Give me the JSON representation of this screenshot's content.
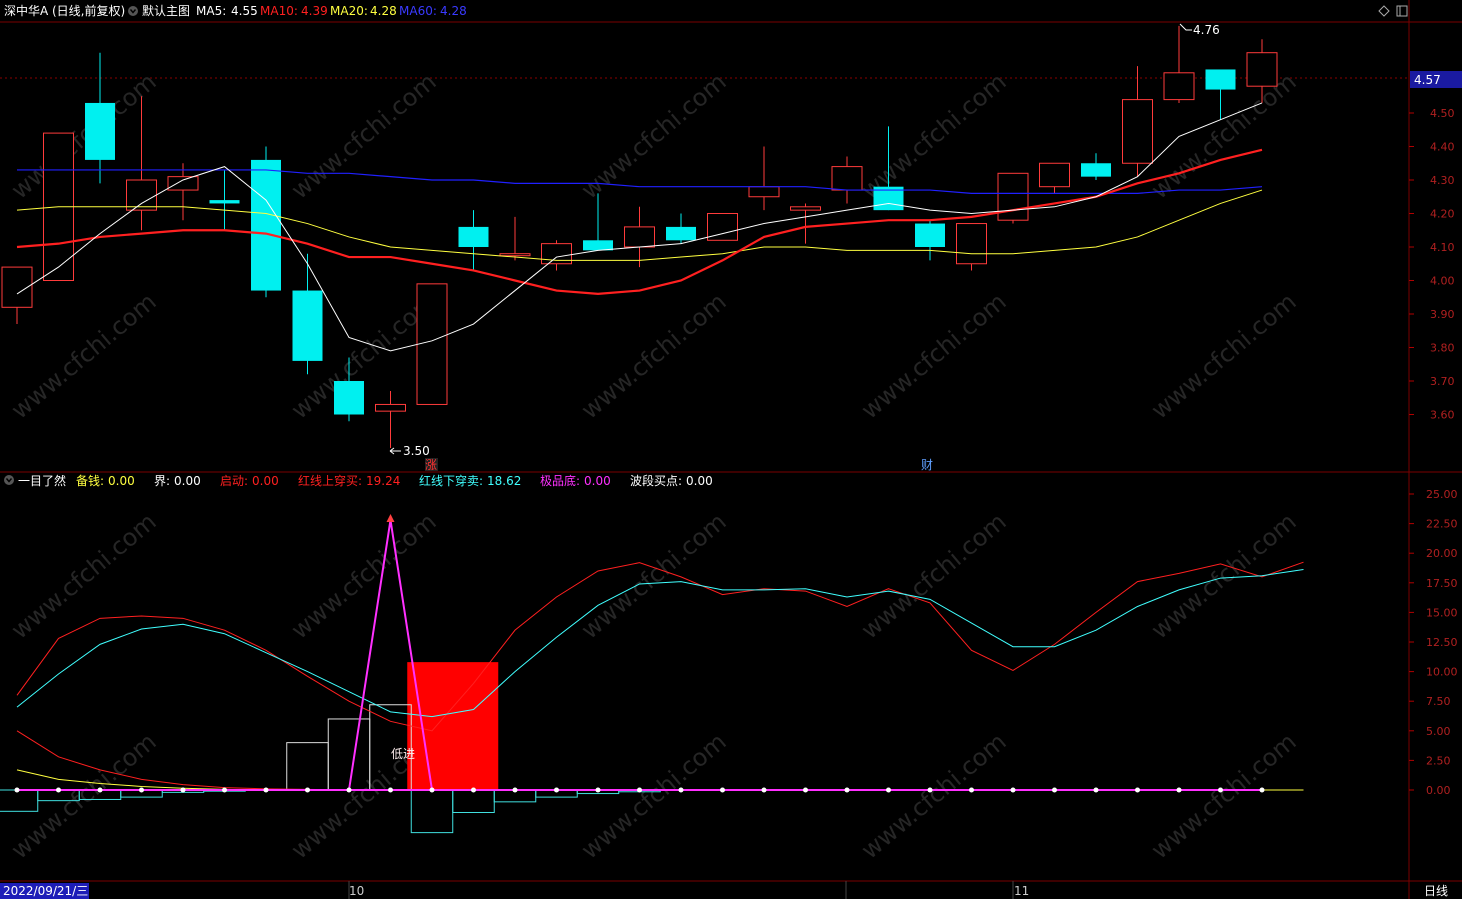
{
  "header": {
    "stock": "深中华A",
    "period_info": "(日线,前复权)",
    "template": "默认主图",
    "ma5": {
      "label": "MA5:",
      "value": "4.55",
      "color": "#ffffff"
    },
    "ma10": {
      "label": "MA10:",
      "value": "4.39",
      "color": "#ff2020"
    },
    "ma20": {
      "label": "MA20:",
      "value": "4.28",
      "color": "#ffff40"
    },
    "ma60": {
      "label": "MA60:",
      "value": "4.28",
      "color": "#2020ff"
    }
  },
  "indicator_header": {
    "name": "一目了然",
    "items": [
      {
        "label": "备钱:",
        "value": "0.00",
        "color": "#ffff40"
      },
      {
        "label": "界:",
        "value": "0.00",
        "color": "#ffffff"
      },
      {
        "label": "启动:",
        "value": "0.00",
        "color": "#ff2020"
      },
      {
        "label": "红线上穿买:",
        "value": "19.24",
        "color": "#ff2020"
      },
      {
        "label": "红线下穿卖:",
        "value": "18.62",
        "color": "#40ffff"
      },
      {
        "label": "极品底:",
        "value": "0.00",
        "color": "#ff30ff"
      },
      {
        "label": "波段买点:",
        "value": "0.00",
        "color": "#ffffff"
      }
    ]
  },
  "price_axis": {
    "ticks": [
      "4.50",
      "4.40",
      "4.30",
      "4.20",
      "4.10",
      "4.00",
      "3.90",
      "3.80",
      "3.70",
      "3.60"
    ],
    "current_price": "4.57",
    "current_price_bg": "#1a1aa0"
  },
  "indicator_axis": {
    "ticks": [
      "25.00",
      "22.50",
      "20.00",
      "17.50",
      "15.00",
      "12.50",
      "10.00",
      "7.50",
      "5.00",
      "2.50",
      "0.00"
    ]
  },
  "annotations": {
    "high_label": "4.76",
    "low_label": "3.50",
    "marker_zhang": "涨",
    "marker_cai": "财",
    "low_entry": "低进"
  },
  "date_axis": {
    "selected_date": "2022/09/21/三",
    "month_oct": "10",
    "month_nov": "11",
    "period": "日线"
  },
  "colors": {
    "up": "#ff3b3b",
    "down": "#00f0f0",
    "grid": "#7a0000"
  },
  "watermark": "www.cfchi.com",
  "chart_data": {
    "type": "candlestick",
    "candles": [
      {
        "o": 3.92,
        "h": 4.04,
        "l": 3.87,
        "c": 4.04
      },
      {
        "o": 4.0,
        "h": 4.44,
        "l": 4.0,
        "c": 4.44
      },
      {
        "o": 4.53,
        "h": 4.68,
        "l": 4.29,
        "c": 4.36
      },
      {
        "o": 4.21,
        "h": 4.55,
        "l": 4.15,
        "c": 4.3
      },
      {
        "o": 4.27,
        "h": 4.35,
        "l": 4.18,
        "c": 4.31
      },
      {
        "o": 4.24,
        "h": 4.33,
        "l": 4.15,
        "c": 4.23
      },
      {
        "o": 4.36,
        "h": 4.4,
        "l": 3.95,
        "c": 3.97
      },
      {
        "o": 3.97,
        "h": 4.08,
        "l": 3.72,
        "c": 3.76
      },
      {
        "o": 3.7,
        "h": 3.77,
        "l": 3.58,
        "c": 3.6
      },
      {
        "o": 3.61,
        "h": 3.67,
        "l": 3.5,
        "c": 3.63
      },
      {
        "o": 3.63,
        "h": 3.99,
        "l": 3.63,
        "c": 3.99
      },
      {
        "o": 4.16,
        "h": 4.21,
        "l": 4.03,
        "c": 4.1
      },
      {
        "o": 4.08,
        "h": 4.19,
        "l": 4.06,
        "c": 4.08
      },
      {
        "o": 4.05,
        "h": 4.12,
        "l": 4.03,
        "c": 4.11
      },
      {
        "o": 4.12,
        "h": 4.26,
        "l": 4.09,
        "c": 4.09
      },
      {
        "o": 4.1,
        "h": 4.22,
        "l": 4.04,
        "c": 4.16
      },
      {
        "o": 4.16,
        "h": 4.2,
        "l": 4.11,
        "c": 4.12
      },
      {
        "o": 4.12,
        "h": 4.2,
        "l": 4.12,
        "c": 4.2
      },
      {
        "o": 4.25,
        "h": 4.4,
        "l": 4.21,
        "c": 4.28
      },
      {
        "o": 4.21,
        "h": 4.23,
        "l": 4.11,
        "c": 4.22
      },
      {
        "o": 4.27,
        "h": 4.37,
        "l": 4.23,
        "c": 4.34
      },
      {
        "o": 4.28,
        "h": 4.46,
        "l": 4.21,
        "c": 4.21
      },
      {
        "o": 4.17,
        "h": 4.18,
        "l": 4.06,
        "c": 4.1
      },
      {
        "o": 4.05,
        "h": 4.17,
        "l": 4.03,
        "c": 4.17
      },
      {
        "o": 4.18,
        "h": 4.32,
        "l": 4.17,
        "c": 4.32
      },
      {
        "o": 4.28,
        "h": 4.35,
        "l": 4.26,
        "c": 4.35
      },
      {
        "o": 4.35,
        "h": 4.38,
        "l": 4.3,
        "c": 4.31
      },
      {
        "o": 4.35,
        "h": 4.64,
        "l": 4.31,
        "c": 4.54
      },
      {
        "o": 4.54,
        "h": 4.76,
        "l": 4.53,
        "c": 4.62
      },
      {
        "o": 4.63,
        "h": 4.63,
        "l": 4.48,
        "c": 4.57
      },
      {
        "o": 4.58,
        "h": 4.72,
        "l": 4.53,
        "c": 4.68
      }
    ],
    "ma5": [
      3.96,
      4.04,
      4.14,
      4.23,
      4.3,
      4.34,
      4.24,
      4.05,
      3.83,
      3.79,
      3.82,
      3.87,
      3.97,
      4.07,
      4.09,
      4.1,
      4.11,
      4.14,
      4.17,
      4.19,
      4.21,
      4.23,
      4.21,
      4.2,
      4.21,
      4.22,
      4.25,
      4.31,
      4.43,
      4.48,
      4.53
    ],
    "ma10": [
      4.1,
      4.11,
      4.13,
      4.14,
      4.15,
      4.15,
      4.14,
      4.11,
      4.07,
      4.07,
      4.05,
      4.03,
      4.0,
      3.97,
      3.96,
      3.97,
      4.0,
      4.06,
      4.13,
      4.16,
      4.17,
      4.18,
      4.18,
      4.19,
      4.21,
      4.23,
      4.25,
      4.29,
      4.32,
      4.36,
      4.39
    ],
    "ma20": [
      4.21,
      4.22,
      4.22,
      4.22,
      4.22,
      4.21,
      4.2,
      4.17,
      4.13,
      4.1,
      4.09,
      4.08,
      4.07,
      4.06,
      4.06,
      4.06,
      4.07,
      4.08,
      4.1,
      4.1,
      4.09,
      4.09,
      4.09,
      4.08,
      4.08,
      4.09,
      4.1,
      4.13,
      4.18,
      4.23,
      4.27
    ],
    "ma60": [
      4.33,
      4.33,
      4.33,
      4.33,
      4.33,
      4.33,
      4.33,
      4.32,
      4.32,
      4.31,
      4.3,
      4.3,
      4.29,
      4.29,
      4.29,
      4.28,
      4.28,
      4.28,
      4.28,
      4.28,
      4.27,
      4.27,
      4.27,
      4.26,
      4.26,
      4.26,
      4.26,
      4.26,
      4.27,
      4.27,
      4.28
    ],
    "indicator": {
      "red_buy": [
        8.0,
        12.8,
        14.5,
        14.7,
        14.5,
        13.5,
        11.8,
        9.6,
        7.5,
        5.8,
        5.0,
        9.0,
        13.5,
        16.3,
        18.5,
        19.2,
        18.0,
        16.5,
        17.0,
        16.8,
        15.5,
        17.0,
        15.8,
        11.8,
        10.1,
        12.3,
        15.0,
        17.6,
        18.3,
        19.1,
        18.0,
        19.24
      ],
      "cyan_sell": [
        7.0,
        9.8,
        12.3,
        13.6,
        14.0,
        13.2,
        11.6,
        10.0,
        8.3,
        6.6,
        6.2,
        6.8,
        10.0,
        12.9,
        15.6,
        17.4,
        17.6,
        16.9,
        16.9,
        17.0,
        16.3,
        16.8,
        16.1,
        14.1,
        12.1,
        12.1,
        13.5,
        15.5,
        16.9,
        17.9,
        18.1,
        18.62
      ],
      "red_line2": [
        5.0,
        2.8,
        1.7,
        0.9,
        0.45,
        0.2,
        0.1,
        0.05,
        0,
        0,
        0,
        0,
        0,
        0,
        0,
        0,
        0,
        0,
        0,
        0,
        0,
        0,
        0,
        0,
        0,
        0,
        0,
        0,
        0,
        0,
        0,
        0
      ],
      "yellow_line": [
        1.7,
        0.9,
        0.55,
        0.3,
        0.15,
        0.05,
        0,
        0,
        0,
        0,
        0,
        0,
        0,
        0,
        0,
        0,
        0,
        0,
        0,
        0,
        0,
        0,
        0,
        0,
        0,
        0,
        0,
        0,
        0,
        0,
        0,
        0
      ],
      "white_steps": [
        0,
        0,
        0,
        0,
        0,
        0,
        0,
        4.0,
        6.0,
        7.2,
        0,
        0,
        0,
        0,
        0,
        0,
        0,
        0,
        0,
        0,
        0,
        0,
        0,
        0,
        0,
        0,
        0,
        0,
        0,
        0,
        0,
        0
      ],
      "cyan_steps": [
        -1.8,
        -0.9,
        -0.8,
        -0.6,
        -0.2,
        -0.1,
        0,
        0,
        0,
        0,
        -3.6,
        -1.9,
        -1.0,
        -0.6,
        -0.3,
        -0.15,
        0,
        0,
        0,
        0,
        0,
        0,
        0,
        0,
        0,
        0,
        0,
        0,
        0,
        0,
        0,
        0
      ],
      "magenta_spike": {
        "index": 9,
        "value": 22.8
      },
      "red_block": {
        "start": 9.5,
        "end": 11.5,
        "value": 10.8
      }
    }
  }
}
